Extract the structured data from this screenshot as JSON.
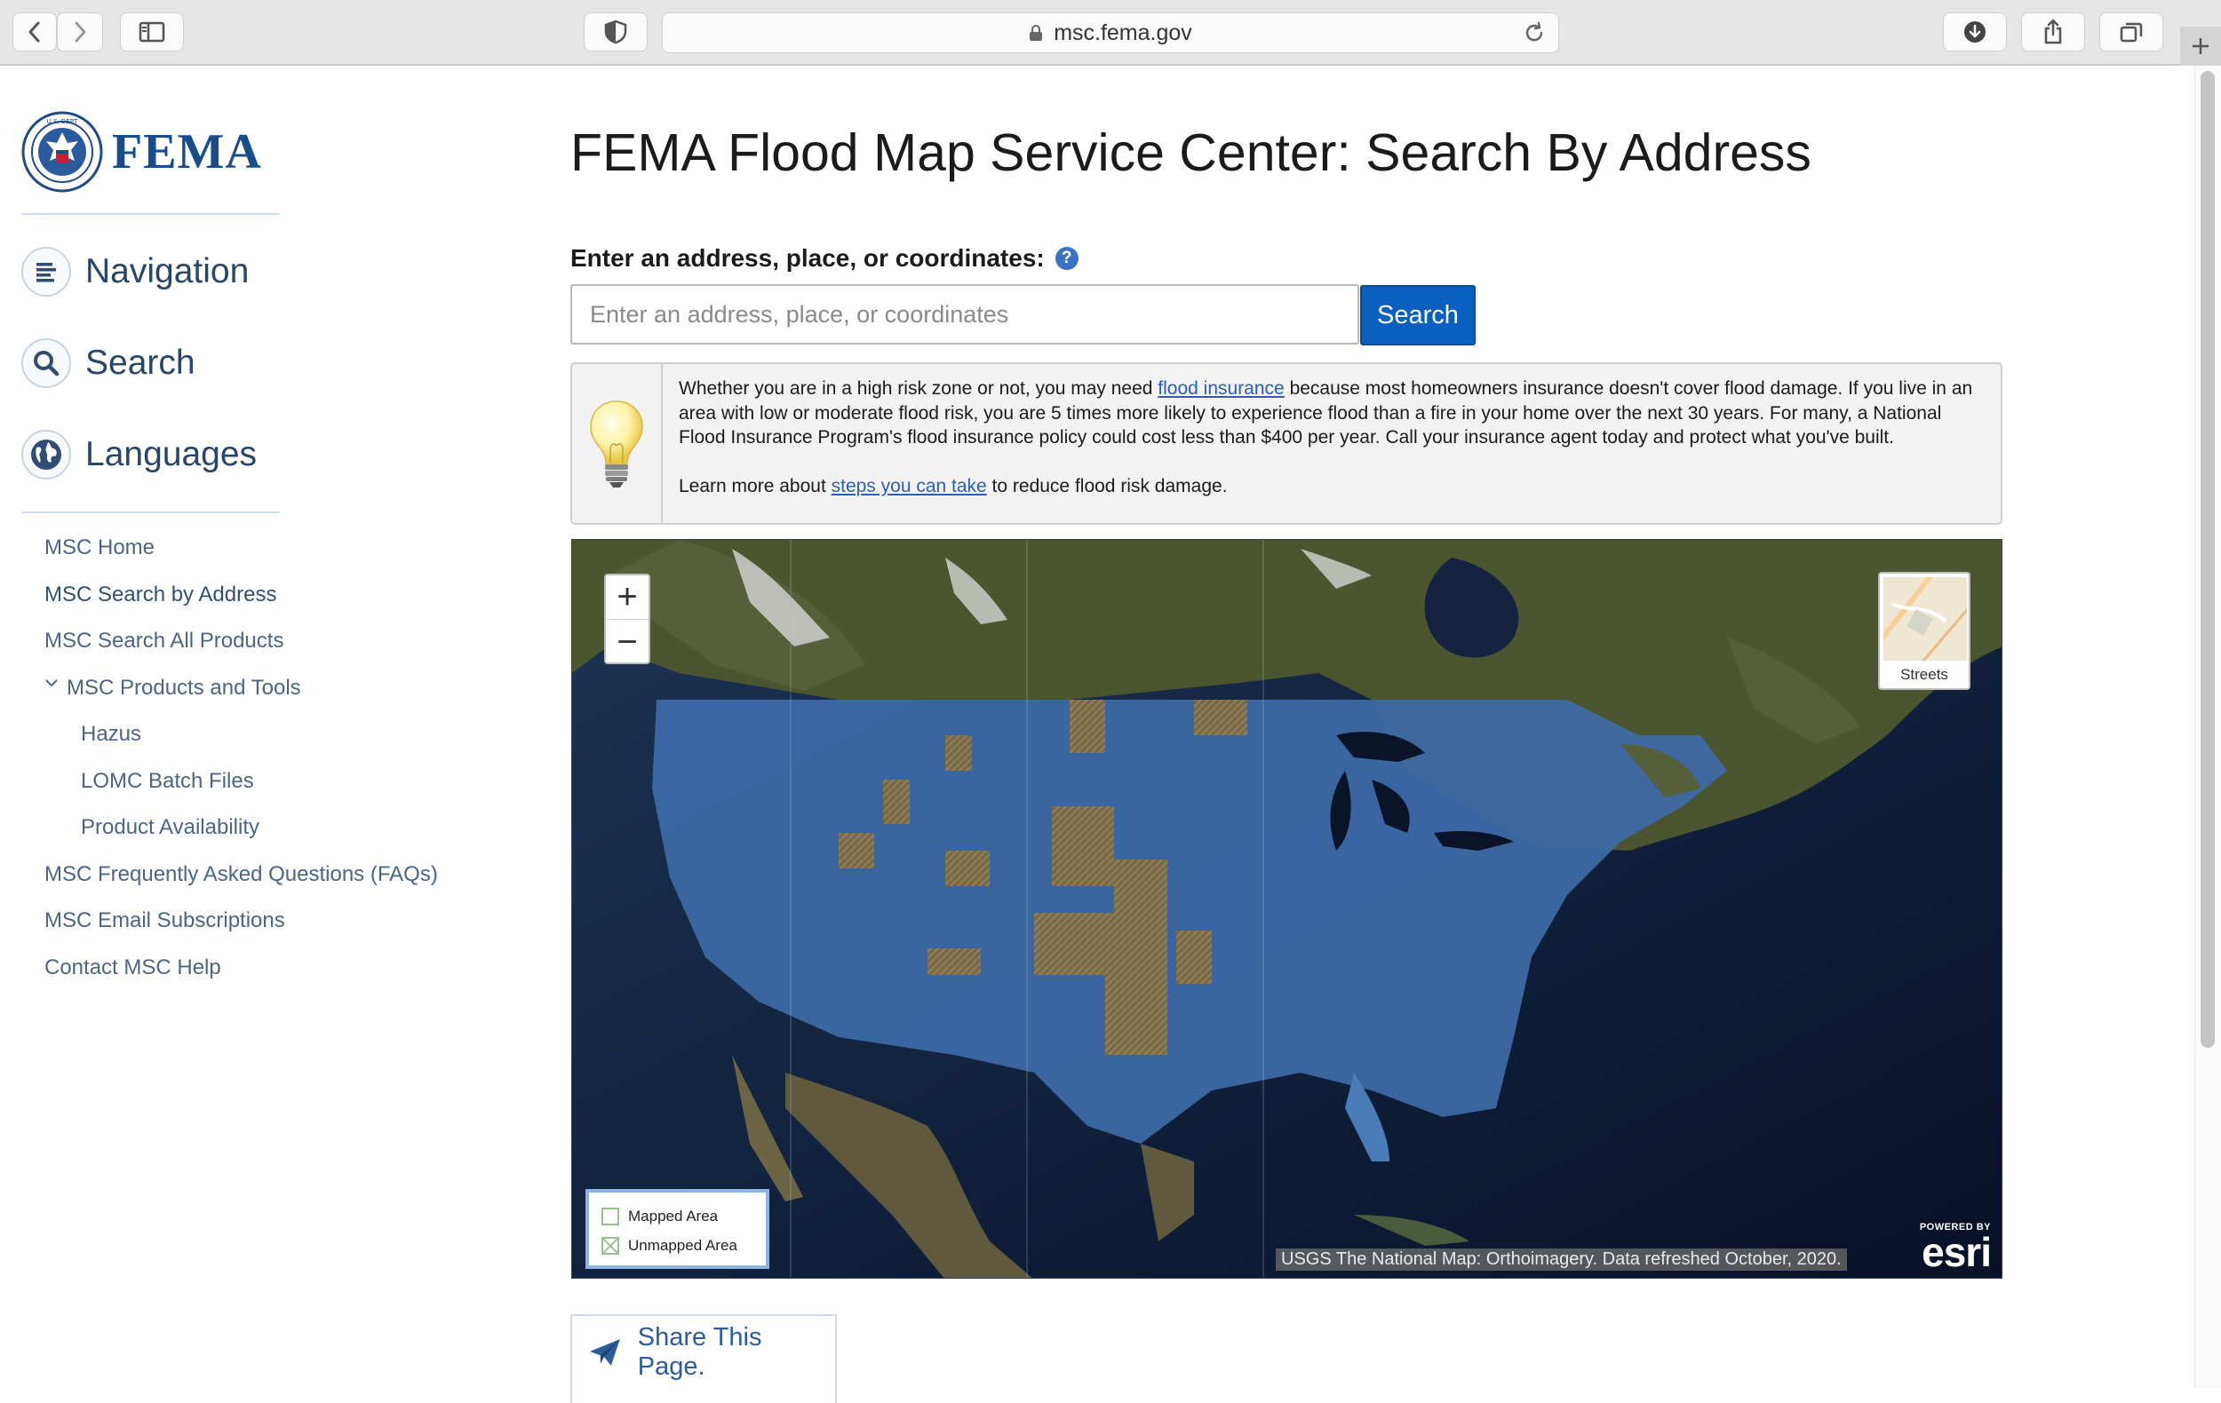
{
  "browser": {
    "url": "msc.fema.gov"
  },
  "sidebar": {
    "logo_text": "FEMA",
    "seal_text": "U.S. DEPARTMENT OF HOMELAND SECURITY",
    "sections": [
      {
        "label": "Navigation",
        "icon": "list-icon"
      },
      {
        "label": "Search",
        "icon": "search-icon"
      },
      {
        "label": "Languages",
        "icon": "globe-icon"
      }
    ],
    "menu": [
      {
        "label": "MSC Home"
      },
      {
        "label": "MSC Search by Address"
      },
      {
        "label": "MSC Search All Products"
      },
      {
        "label": "MSC Products and Tools",
        "expanded": true
      },
      {
        "label": "Hazus"
      },
      {
        "label": "LOMC Batch Files"
      },
      {
        "label": "Product Availability"
      },
      {
        "label": "MSC Frequently Asked Questions (FAQs)"
      },
      {
        "label": "MSC Email Subscriptions"
      },
      {
        "label": "Contact MSC Help"
      }
    ]
  },
  "main": {
    "title": "FEMA Flood Map Service Center: Search By Address",
    "search_label": "Enter an address, place, or coordinates:",
    "help_icon": "?",
    "search_placeholder": "Enter an address, place, or coordinates",
    "search_button": "Search",
    "tip": {
      "p1_a": "Whether you are in a high risk zone or not, you may need ",
      "p1_link": "flood insurance",
      "p1_b": " because most homeowners insurance doesn't cover flood damage. If you live in an area with low or moderate flood risk, you are 5 times more likely to experience flood than a fire in your home over the next 30 years. For many, a National Flood Insurance Program's flood insurance policy could cost less than $400 per year. Call your insurance agent today and protect what you've built.",
      "p2_a": "Learn more about ",
      "p2_link": "steps you can take",
      "p2_b": " to reduce flood risk damage."
    },
    "map": {
      "zoom_in": "+",
      "zoom_out": "−",
      "basemap_label": "Streets",
      "legend": [
        {
          "label": "Mapped Area"
        },
        {
          "label": "Unmapped Area"
        }
      ],
      "attribution": "USGS The National Map: Orthoimagery. Data refreshed October, 2020.",
      "esri_powered": "POWERED BY",
      "esri_logo": "esri"
    },
    "share_label": "Share This Page."
  }
}
